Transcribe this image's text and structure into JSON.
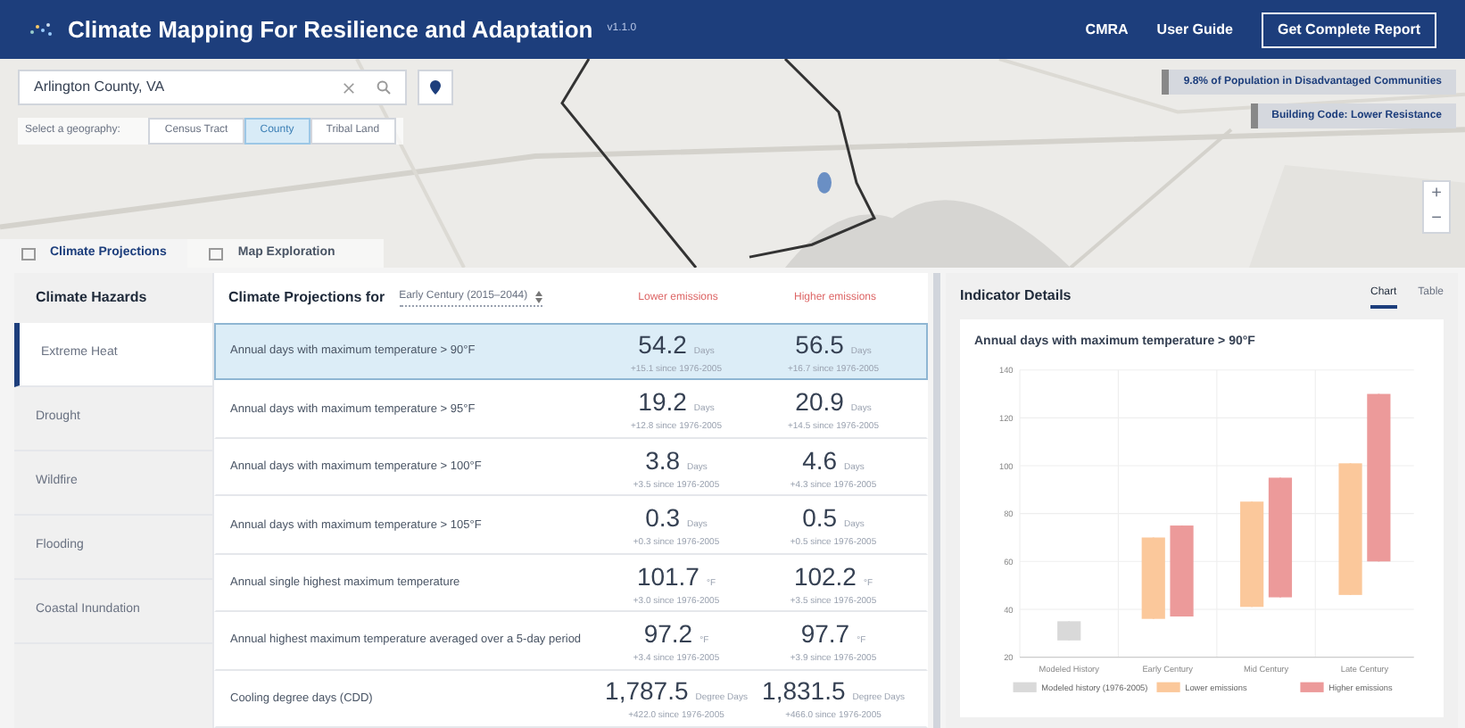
{
  "header": {
    "title": "Climate Mapping For Resilience and Adaptation",
    "version": "v1.1.0",
    "links": [
      "CMRA",
      "User Guide"
    ],
    "report_button": "Get Complete Report"
  },
  "map": {
    "search": {
      "value": "Arlington County, VA"
    },
    "geography_label": "Select a geography:",
    "geographies": [
      {
        "label": "Census Tract",
        "selected": false
      },
      {
        "label": "County",
        "selected": true
      },
      {
        "label": "Tribal Land",
        "selected": false
      }
    ],
    "badges": [
      "9.8% of Population in Disadvantaged Communities",
      "Building Code: Lower Resistance"
    ],
    "zoom": [
      "+",
      "−"
    ]
  },
  "view_tabs": [
    {
      "label": "Climate Projections",
      "selected": true
    },
    {
      "label": "Map Exploration",
      "selected": false
    }
  ],
  "hazards": {
    "title": "Climate Hazards",
    "items": [
      {
        "label": "Extreme Heat",
        "selected": true
      },
      {
        "label": "Drought",
        "selected": false
      },
      {
        "label": "Wildfire",
        "selected": false
      },
      {
        "label": "Flooding",
        "selected": false
      },
      {
        "label": "Coastal Inundation",
        "selected": false
      }
    ]
  },
  "projections": {
    "title": "Climate Projections for",
    "period": "Early Century (2015–2044)",
    "columns": [
      "Lower emissions",
      "Higher emissions"
    ],
    "rows": [
      {
        "label": "Annual days with maximum temperature > 90°F",
        "selected": true,
        "lower": {
          "value": "54.2",
          "unit": "Days",
          "change": "+15.1 since 1976-2005"
        },
        "higher": {
          "value": "56.5",
          "unit": "Days",
          "change": "+16.7 since 1976-2005"
        }
      },
      {
        "label": "Annual days with maximum temperature > 95°F",
        "selected": false,
        "lower": {
          "value": "19.2",
          "unit": "Days",
          "change": "+12.8 since 1976-2005"
        },
        "higher": {
          "value": "20.9",
          "unit": "Days",
          "change": "+14.5 since 1976-2005"
        }
      },
      {
        "label": "Annual days with maximum temperature > 100°F",
        "selected": false,
        "lower": {
          "value": "3.8",
          "unit": "Days",
          "change": "+3.5 since 1976-2005"
        },
        "higher": {
          "value": "4.6",
          "unit": "Days",
          "change": "+4.3 since 1976-2005"
        }
      },
      {
        "label": "Annual days with maximum temperature > 105°F",
        "selected": false,
        "lower": {
          "value": "0.3",
          "unit": "Days",
          "change": "+0.3 since 1976-2005"
        },
        "higher": {
          "value": "0.5",
          "unit": "Days",
          "change": "+0.5 since 1976-2005"
        }
      },
      {
        "label": "Annual single highest maximum temperature",
        "selected": false,
        "lower": {
          "value": "101.7",
          "unit": "°F",
          "change": "+3.0 since 1976-2005"
        },
        "higher": {
          "value": "102.2",
          "unit": "°F",
          "change": "+3.5 since 1976-2005"
        }
      },
      {
        "label": "Annual highest maximum temperature averaged over a 5-day period",
        "selected": false,
        "lower": {
          "value": "97.2",
          "unit": "°F",
          "change": "+3.4 since 1976-2005"
        },
        "higher": {
          "value": "97.7",
          "unit": "°F",
          "change": "+3.9 since 1976-2005"
        }
      },
      {
        "label": "Cooling degree days (CDD)",
        "selected": false,
        "lower": {
          "value": "1,787.5",
          "unit": "Degree Days",
          "change": "+422.0 since 1976-2005"
        },
        "higher": {
          "value": "1,831.5",
          "unit": "Degree Days",
          "change": "+466.0 since 1976-2005"
        }
      }
    ]
  },
  "details": {
    "title": "Indicator Details",
    "tabs": [
      {
        "label": "Chart",
        "selected": true
      },
      {
        "label": "Table",
        "selected": false
      }
    ],
    "chart_data": {
      "type": "candlestick",
      "title": "Annual days with maximum temperature > 90°F",
      "categories": [
        "Modeled History",
        "Early Century",
        "Mid Century",
        "Late Century"
      ],
      "ylim": [
        20,
        140
      ],
      "yticks": [
        20,
        40,
        60,
        80,
        100,
        120,
        140
      ],
      "grid": true,
      "legend": true,
      "series": [
        {
          "name": "Modeled history (1976-2005)",
          "color": "#d9d9d9",
          "ohlc": [
            [
              27,
              35,
              27,
              35
            ],
            null,
            null,
            null
          ]
        },
        {
          "name": "Lower emissions",
          "color": "#fbc89b",
          "ohlc": [
            null,
            [
              36,
              70,
              36,
              70
            ],
            [
              41,
              85,
              41,
              85
            ],
            [
              46,
              101,
              46,
              101
            ]
          ]
        },
        {
          "name": "Higher emissions",
          "color": "#ec9a9a",
          "ohlc": [
            null,
            [
              37,
              75,
              37,
              75
            ],
            [
              45,
              95,
              45,
              95
            ],
            [
              60,
              130,
              60,
              130
            ]
          ]
        }
      ]
    }
  }
}
